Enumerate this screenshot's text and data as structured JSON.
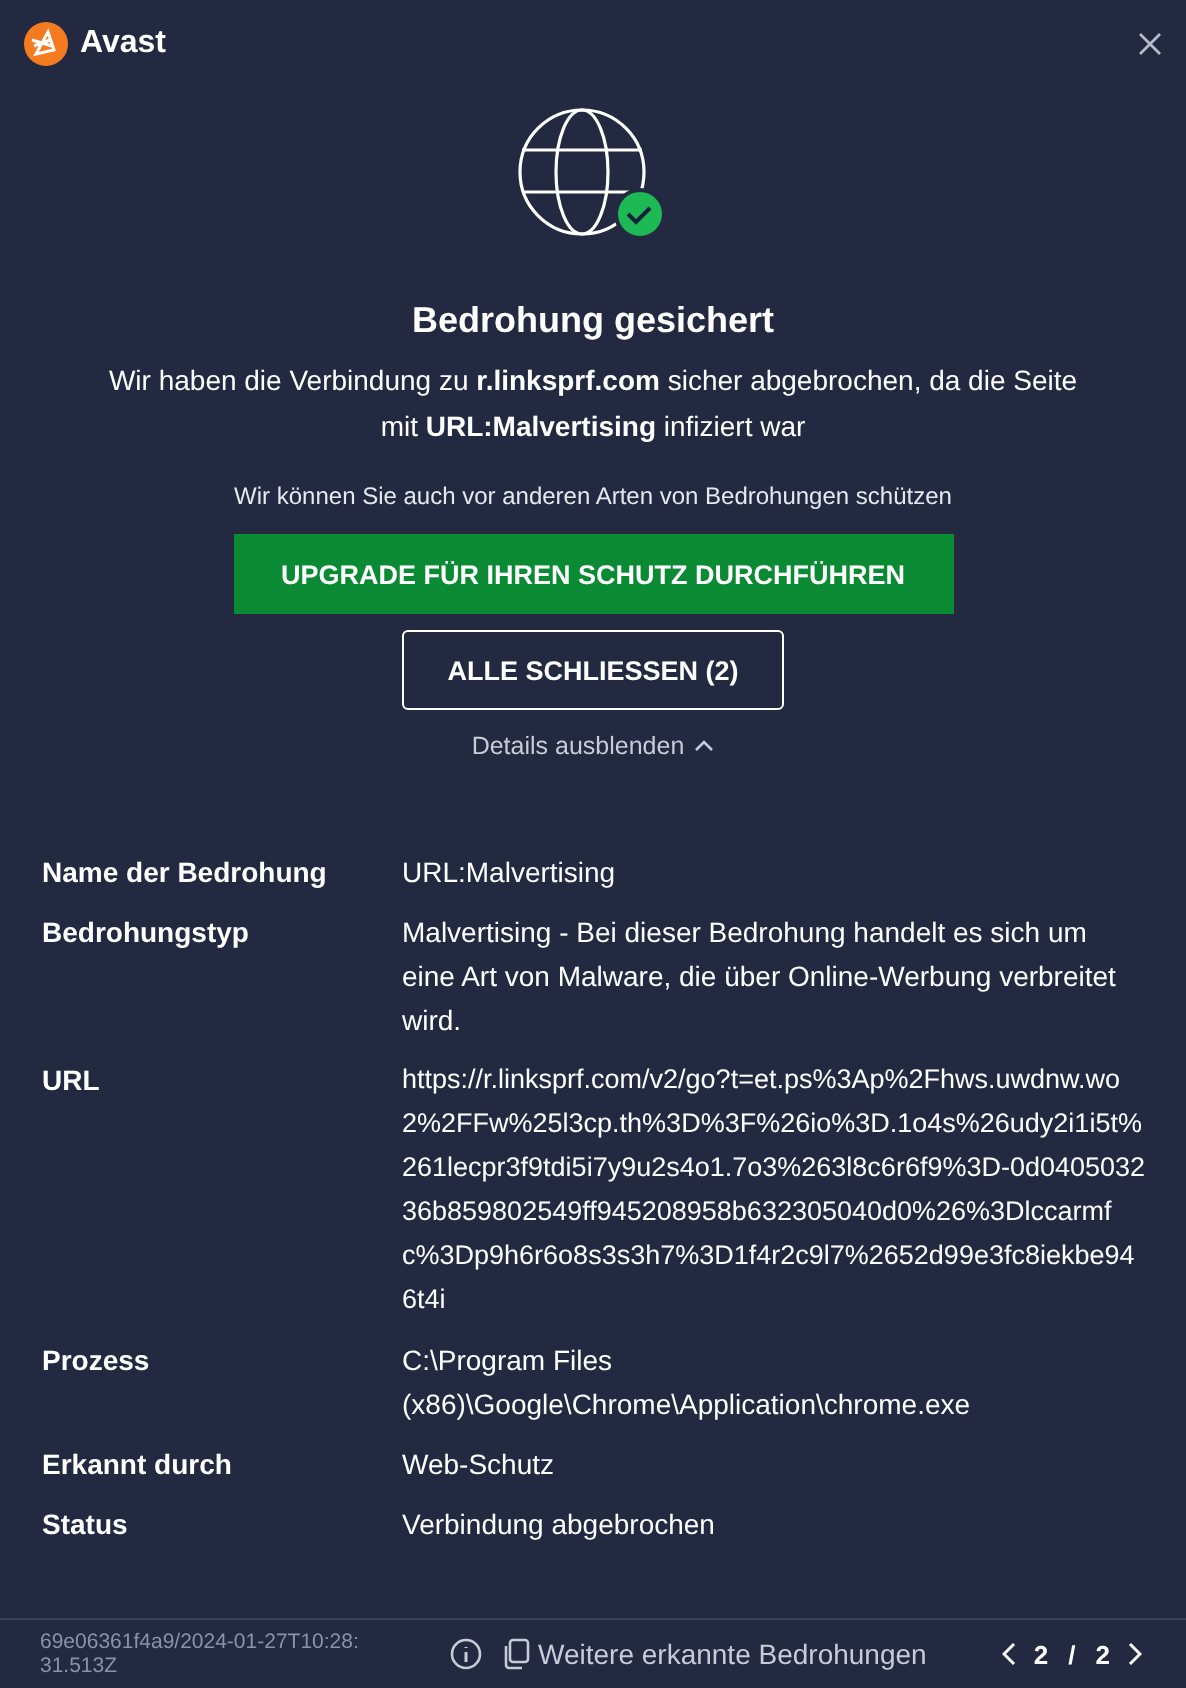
{
  "window": {
    "title": "Avast"
  },
  "hero": {
    "title": "Bedrohung gesichert",
    "message": "Wir haben die Verbindung zu **r.linksprf.com** sicher abgebrochen, da die Seite mit **URL:Malvertising** infiziert war",
    "subtext": "Wir können Sie auch vor anderen Arten von Bedrohungen schützen"
  },
  "buttons": [
    {
      "label": "UPGRADE FÜR IHREN SCHUTZ DURCHFÜHREN",
      "kind": "primary"
    },
    {
      "label": "ALLE SCHLIESSEN (2)",
      "kind": "outline"
    }
  ],
  "details_toggle": {
    "label": "Details ausblenden",
    "expanded": true
  },
  "details": [
    {
      "label": "Name der Bedrohung",
      "value": "URL:Malvertising"
    },
    {
      "label": "Bedrohungstyp",
      "value": "Malvertising - Bei dieser Bedrohung handelt es sich um eine Art von Malware, die über Online-Werbung verbreitet wird."
    },
    {
      "label": "URL",
      "value": "https://r.linksprf.com/v2/go?t=et.ps%3Ap%2Fhws.uwdnw.wo2%2FFw%25l3cp.th%3D%3F%26io%3D.1o4s%26udy2i1i5t%261lecpr3f9tdi5i7y9u2s4o1.7o3%263l8c6r6f9%3D-0d040503236b859802549ff945208958b632305040d0%26%3Dlccarmfc%3Dp9h6r6o8s3s3h7%3D1f4r2c9l7%2652d99e3fc8iekbe946t4i",
      "kind": "url"
    },
    {
      "label": "Prozess",
      "value": "C:\\Program Files (x86)\\Google\\Chrome\\Application\\chrome.exe"
    },
    {
      "label": "Erkannt durch",
      "value": "Web-Schutz"
    },
    {
      "label": "Status",
      "value": "Verbindung abgebrochen"
    }
  ],
  "footer": {
    "id": "69e06361f4a9/2024-01-27T10:28:31.513Z",
    "link": "Weitere erkannte Bedrohungen",
    "pager": {
      "current": "2",
      "separator": "/",
      "total": "2"
    }
  }
}
